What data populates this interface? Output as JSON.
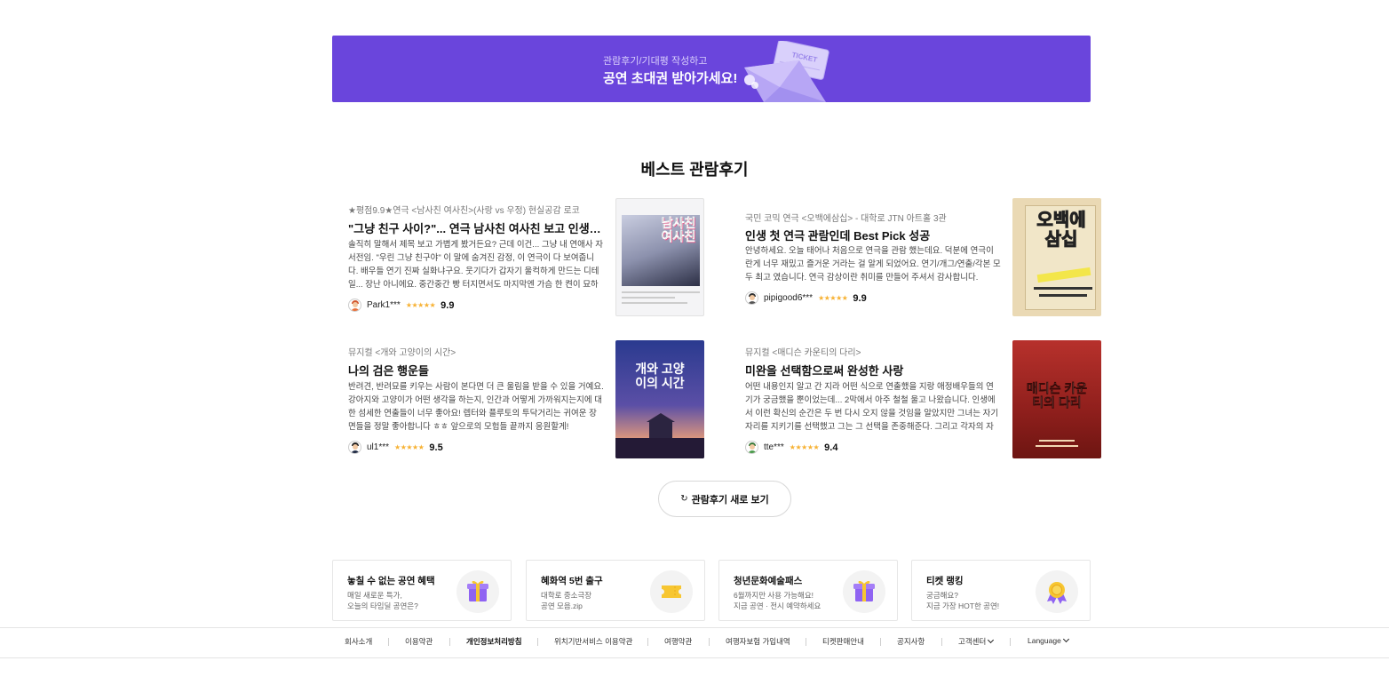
{
  "banner": {
    "subtitle": "관람후기/기대평 작성하고",
    "title": "공연 초대권 받아가세요!",
    "ticket_label": "TICKET"
  },
  "section_title": "베스트 관람후기",
  "reviews": [
    {
      "meta": "★평점9.9★연극 <남사친 여사친>(사랑 vs 우정) 현실공감 로코",
      "title": "\"그냥 친구 사이?\"... 연극 남사친 여사친 보고 인생 돌아봄",
      "body": "솔직히 말해서 제목 보고 가볍게 봤거든요? 근데 이건... 그냥 내 연애사 자서전임. \"우린 그냥 친구야\" 이 말에 숨겨진 감정, 이 연극이 다 보여줍니다. 배우들 연기 진짜 실화냐구요. 웃기다가 갑자기 울컥하게 만드는 디테일... 장난 아니에요. 중간중간 빵 터지면서도 마지막엔 가슴 한 켠이 묘하게 아려옵니다.",
      "user": "Park1***",
      "stars": "★★★★★",
      "score": "9.9",
      "poster_text": "남사친 여사친"
    },
    {
      "meta": "국민 코믹 연극 <오백에삼십> - 대학로 JTN 아트홀 3관",
      "title": "인생 첫 연극 관람인데 Best Pick 성공",
      "body": "안녕하세요. 오늘 태어나 처음으로 연극을 관람 했는데요. 덕분에 연극이란게 너무 재밌고 즐거운 거라는 걸 알게 되었어요. 연기/개그/연출/각본 모두 최고 였습니다. 연극 감상이란 취미를 만들어 주셔서 감사합니다.",
      "user": "pipigood6***",
      "stars": "★★★★★",
      "score": "9.9",
      "poster_text": "오백에 삼십"
    },
    {
      "meta": "뮤지컬 <개와 고양이의 시간>",
      "title": "나의 검은 행운들",
      "body": "반려견, 반려묘를 키우는 사람이 본다면 더 큰 울림을 받을 수 있을 거예요. 강아지와 고양이가 어떤 생각을 하는지, 인간과 어떻게 가까워지는지에 대한 섬세한 연출들이 너무 좋아요! 렙터와 플루토의 투닥거리는 귀여운 장면들을 정말 좋아합니다 ㅎㅎ 앞으로의 모험들 끝까지 응원할게!",
      "user": "ul1***",
      "stars": "★★★★★",
      "score": "9.5",
      "poster_text": "개와 고양이의 시간"
    },
    {
      "meta": "뮤지컬 <매디슨 카운티의 다리>",
      "title": "미완을 선택함으로써 완성한 사랑",
      "body": "어떤 내용인지 알고 간 지라 어떤 식으로 연출했을 지랑 애정배우들의 연기가 궁금했을 뿐이었는데... 2막에서 아주 철철 울고 나왔습니다. 인생에서 이런 확신의 순간은 두 번 다시 오지 않을 것임을 알았지만 그녀는 자기 자리를 지키기를 선택했고 그는 그 선택을 존중해준다. 그리고 각자의 자리에서 서로를 평생 그리워한다.",
      "user": "tte***",
      "stars": "★★★★★",
      "score": "9.4",
      "poster_text": "매디슨 카운티의 다리"
    }
  ],
  "refresh_button": {
    "icon": "↻",
    "label": "관람후기 새로 보기"
  },
  "promos": [
    {
      "title": "놓칠 수 없는 공연 혜택",
      "desc": "매일 새로운 특가,\n오늘의 타임딜 공연은?",
      "icon": "gift-icon"
    },
    {
      "title": "혜화역 5번 출구",
      "desc": "대학로 중소극장\n공연 모음.zip",
      "icon": "ticket-icon"
    },
    {
      "title": "청년문화예술패스",
      "desc": "6월까지만 사용 가능해요!\n지금 공연 · 전시 예약하세요",
      "icon": "gift-icon"
    },
    {
      "title": "티켓 랭킹",
      "desc": "궁금해요?\n지금 가장 HOT한 공연!",
      "icon": "medal-icon"
    }
  ],
  "footer": {
    "links": [
      "회사소개",
      "이용약관",
      "개인정보처리방침",
      "위치기반서비스 이용약관",
      "여행약관",
      "여행자보험 가입내역",
      "티켓판매안내",
      "공지사항",
      "고객센터",
      "Language"
    ]
  },
  "colors": {
    "banner_bg": "#6a45dc",
    "star": "#f7b234",
    "gift": "#8f63f2",
    "ticket": "#f7c631"
  }
}
